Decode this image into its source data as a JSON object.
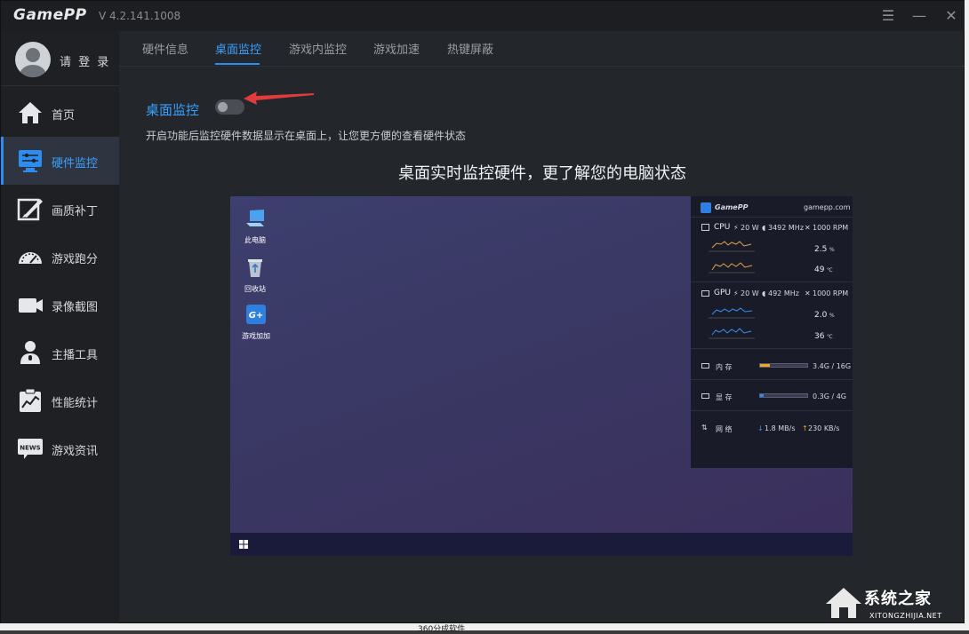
{
  "app": {
    "logo": "GamePP",
    "version": "V 4.2.141.1008"
  },
  "window_controls": {
    "menu": "☰",
    "minimize": "—",
    "close": "✕"
  },
  "sidebar": {
    "login_label": "请 登 录",
    "items": [
      {
        "label": "首页",
        "icon": "home-icon"
      },
      {
        "label": "硬件监控",
        "icon": "monitor-sliders-icon",
        "active": true
      },
      {
        "label": "画质补丁",
        "icon": "brush-icon"
      },
      {
        "label": "游戏跑分",
        "icon": "speedometer-icon"
      },
      {
        "label": "录像截图",
        "icon": "video-camera-icon"
      },
      {
        "label": "主播工具",
        "icon": "streamer-icon"
      },
      {
        "label": "性能统计",
        "icon": "chart-clipboard-icon"
      },
      {
        "label": "游戏资讯",
        "icon": "news-icon"
      }
    ]
  },
  "tabs": [
    {
      "label": "硬件信息"
    },
    {
      "label": "桌面监控",
      "active": true
    },
    {
      "label": "游戏内监控"
    },
    {
      "label": "游戏加速"
    },
    {
      "label": "热键屏蔽"
    }
  ],
  "setting": {
    "label": "桌面监控",
    "enabled": false,
    "description": "开启功能后监控硬件数据显示在桌面上，让您更方便的查看硬件状态"
  },
  "headline": "桌面实时监控硬件，更了解您的电脑状态",
  "preview": {
    "desktop_icons": [
      {
        "label": "此电脑",
        "icon": "computer-icon"
      },
      {
        "label": "回收站",
        "icon": "recycle-bin-icon"
      },
      {
        "label": "游戏加加",
        "icon": "gamepp-app-icon"
      }
    ],
    "overlay": {
      "brand": "GamePP",
      "site": "gamepp.com",
      "cpu": {
        "label": "CPU",
        "power": "20 W",
        "clock": "3492 MHz",
        "fan": "1000 RPM",
        "usage": "2.5",
        "usage_unit": "%",
        "temp": "49",
        "temp_unit": "℃"
      },
      "gpu": {
        "label": "GPU",
        "power": "20 W",
        "clock": "492 MHz",
        "fan": "1000 RPM",
        "usage": "2.0",
        "usage_unit": "%",
        "temp": "36",
        "temp_unit": "℃"
      },
      "memory": {
        "label": "内  存",
        "value": "3.4G / 16G",
        "fraction": 0.21,
        "color": "#f0a81e"
      },
      "vram": {
        "label": "显  存",
        "value": "0.3G / 4G",
        "fraction": 0.08,
        "color": "#2d8cf0"
      },
      "network": {
        "label": "网  络",
        "down": "1.8 MB/s",
        "up": "230 KB/s"
      }
    }
  },
  "watermark": {
    "main": "系统之家",
    "sub": "XITONGZHIJIA.NET"
  },
  "background": {
    "bottom_text": "360分成软件"
  },
  "colors": {
    "accent": "#2d8cf0",
    "arrow": "#e23b3b"
  }
}
